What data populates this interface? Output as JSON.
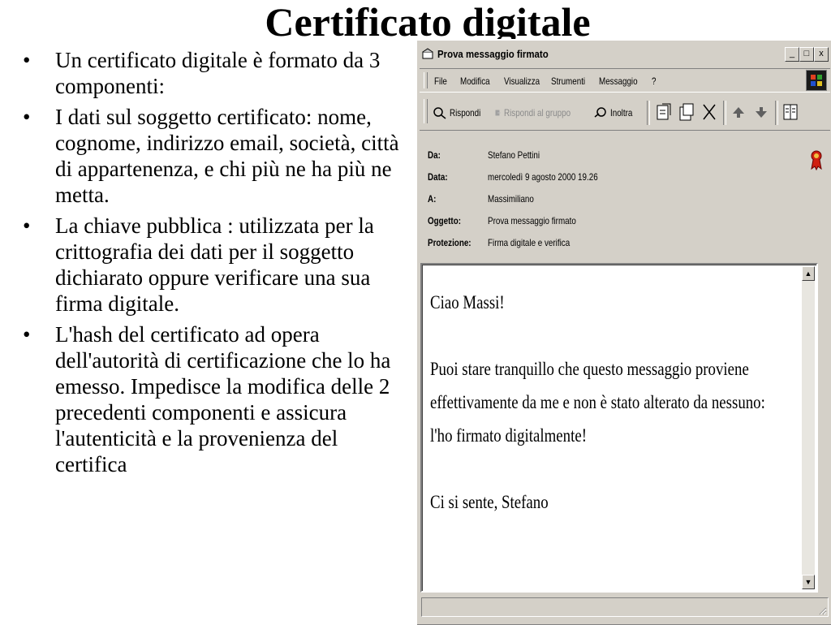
{
  "slide": {
    "title": "Certificato digitale",
    "bullets": [
      "Un certificato digitale è formato da 3 componenti:",
      "I dati sul soggetto certificato: nome, cognome, indirizzo email, società, città di appartenenza, e chi più ne ha più ne metta.",
      "La chiave pubblica : utilizzata per la crittografia dei dati per il soggetto dichiarato oppure verificare una sua firma digitale.",
      "L'hash  del certificato ad opera dell'autorità di certificazione che lo ha emesso. Impedisce la modifica delle 2 precedenti componenti e assicura l'autenticità e la provenienza del certifica"
    ],
    "bullet_glyph": "•"
  },
  "window": {
    "title": "Prova messaggio firmato",
    "controls": {
      "minimize": "_",
      "maximize": "□",
      "close": "x"
    },
    "menu": [
      "File",
      "Modifica",
      "Visualizza",
      "Strumenti",
      "Messaggio",
      "?"
    ],
    "toolbar": {
      "reply": "Rispondi",
      "reply_group": "Rispondi al gruppo",
      "forward": "Inoltra"
    },
    "icons": {
      "reply": "reply-icon",
      "reply_group": "reply-group-icon",
      "forward": "forward-icon",
      "print": "print-icon",
      "copy": "copy-icon",
      "delete": "delete-icon",
      "previous": "up-arrow-icon",
      "next": "down-arrow-icon",
      "addresses": "address-book-icon",
      "signature": "ribbon-icon"
    },
    "headers": [
      {
        "key": "Da:",
        "value": "Stefano Pettini"
      },
      {
        "key": "Data:",
        "value": "mercoledì 9 agosto 2000 19.26"
      },
      {
        "key": "A:",
        "value": "Massimiliano"
      },
      {
        "key": "Oggetto:",
        "value": "Prova messaggio firmato"
      },
      {
        "key": "Protezione:",
        "value": "Firma digitale e verifica"
      }
    ],
    "body": [
      "Ciao Massi!",
      "",
      "Puoi stare tranquillo che questo messaggio proviene",
      "effettivamente da me e non è stato alterato da nessuno:",
      "l'ho firmato digitalmente!",
      "",
      "Ci si sente, Stefano"
    ],
    "colors": {
      "chrome": "#d4d0c8",
      "body_bg": "#ffffff",
      "disabled_text": "#8a8a8a"
    }
  }
}
